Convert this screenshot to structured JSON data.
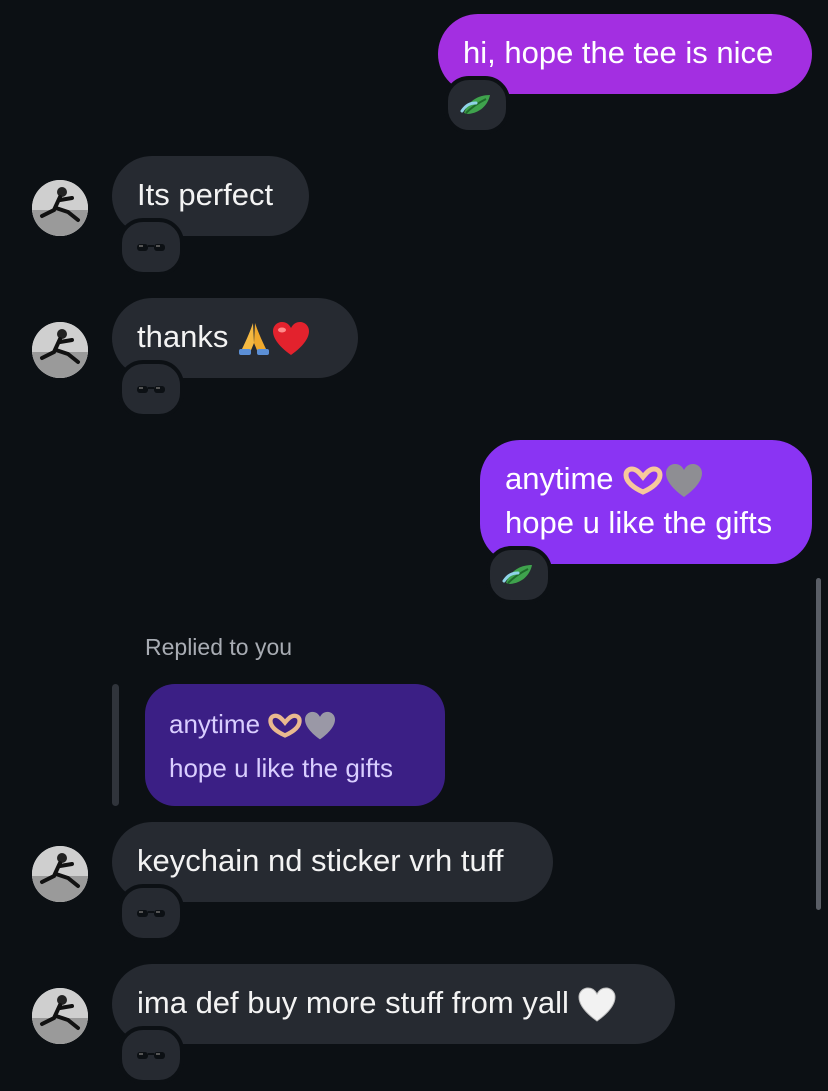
{
  "colors": {
    "background": "#0c1014",
    "incoming_bubble": "#262a31",
    "outgoing_bubble_top": "#a230e0",
    "outgoing_bubble_bottom": "#8a35f5",
    "reply_quote": "#3b1f85"
  },
  "messages": [
    {
      "direction": "outgoing",
      "lines": [
        "hi, hope the tee is nice"
      ],
      "reaction": "leaf-emoji"
    },
    {
      "direction": "incoming",
      "lines": [
        "Its perfect"
      ],
      "reaction": "sunglasses-emoji"
    },
    {
      "direction": "incoming",
      "lines": [
        "thanks "
      ],
      "reaction": "sunglasses-emoji",
      "emojis": [
        "praying-hands-emoji",
        "red-heart-emoji"
      ]
    },
    {
      "direction": "outgoing",
      "lines": [
        "anytime ",
        "hope u like the gifts"
      ],
      "reaction": "leaf-emoji",
      "emojis": [
        "heart-hands-emoji",
        "grey-heart-emoji"
      ]
    },
    {
      "direction": "incoming",
      "lines": [
        "keychain nd sticker vrh tuff"
      ],
      "reaction": "sunglasses-emoji"
    },
    {
      "direction": "incoming",
      "lines": [
        "ima def buy more stuff from yall "
      ],
      "reaction": "sunglasses-emoji",
      "emojis": [
        "white-heart-emoji"
      ]
    }
  ],
  "reply": {
    "label": "Replied to you",
    "quoted_lines": [
      "anytime ",
      "hope u like the gifts"
    ],
    "emojis": [
      "heart-hands-emoji",
      "grey-heart-emoji"
    ]
  }
}
